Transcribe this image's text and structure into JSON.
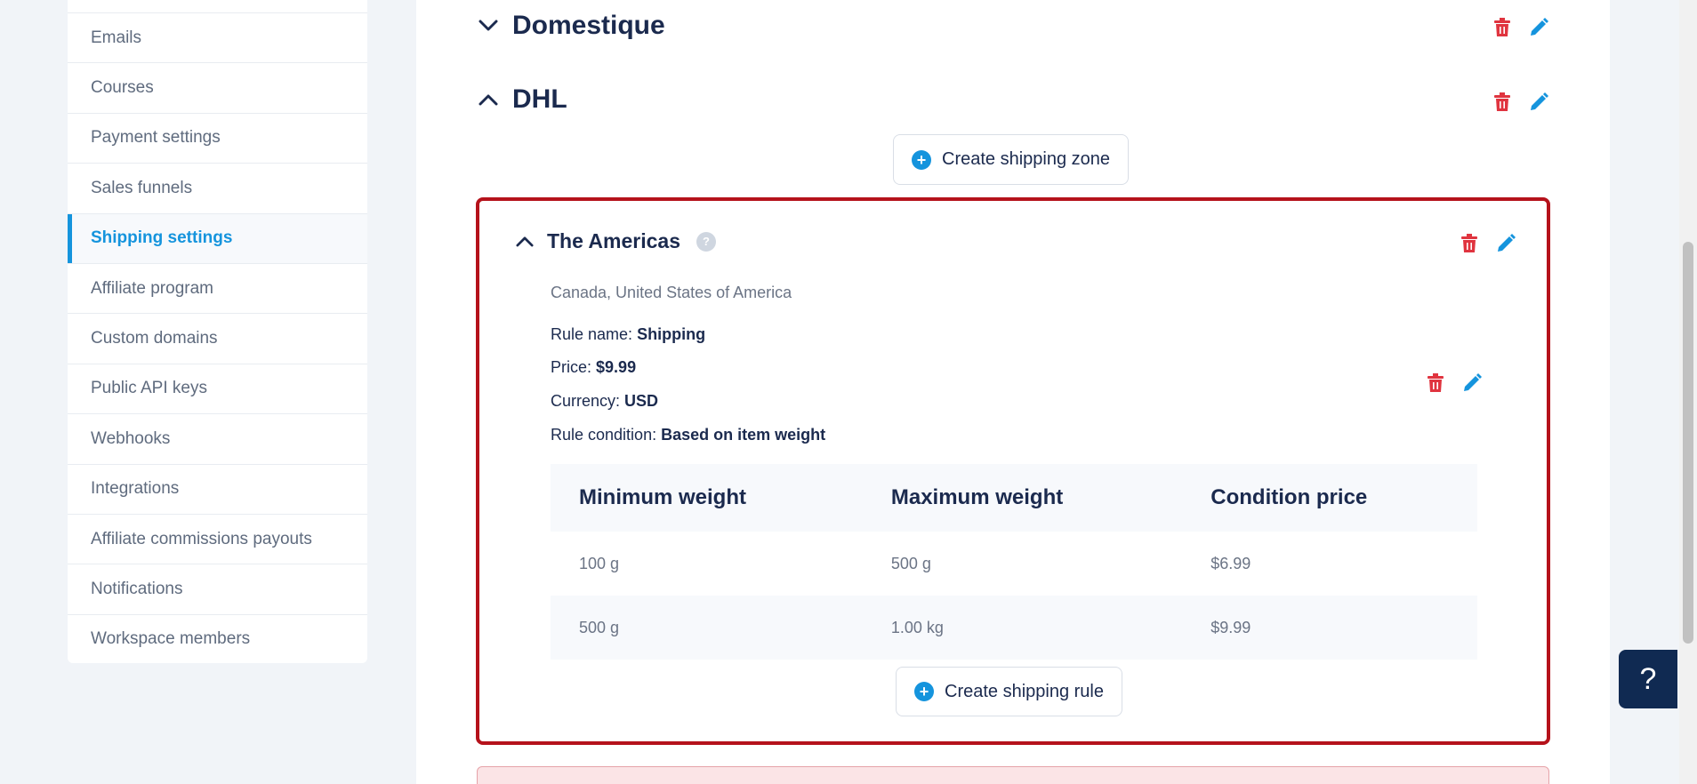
{
  "sidebar": {
    "items": [
      {
        "label": "Emails",
        "active": false
      },
      {
        "label": "Courses",
        "active": false
      },
      {
        "label": "Payment settings",
        "active": false
      },
      {
        "label": "Sales funnels",
        "active": false
      },
      {
        "label": "Shipping settings",
        "active": true
      },
      {
        "label": "Affiliate program",
        "active": false
      },
      {
        "label": "Custom domains",
        "active": false
      },
      {
        "label": "Public API keys",
        "active": false
      },
      {
        "label": "Webhooks",
        "active": false
      },
      {
        "label": "Integrations",
        "active": false
      },
      {
        "label": "Affiliate commissions payouts",
        "active": false
      },
      {
        "label": "Notifications",
        "active": false
      },
      {
        "label": "Workspace members",
        "active": false
      }
    ]
  },
  "groups": [
    {
      "name": "Domestique",
      "expanded": false
    },
    {
      "name": "DHL",
      "expanded": true
    }
  ],
  "create_zone_label": "Create shipping zone",
  "zone": {
    "name": "The Americas",
    "help": "?",
    "countries": "Canada, United States of America",
    "rule": {
      "name_label": "Rule name:",
      "name_value": "Shipping",
      "price_label": "Price:",
      "price_value": "$9.99",
      "currency_label": "Currency:",
      "currency_value": "USD",
      "condition_label": "Rule condition:",
      "condition_value": "Based on item weight"
    },
    "table": {
      "headers": [
        "Minimum weight",
        "Maximum weight",
        "Condition price"
      ],
      "rows": [
        [
          "100 g",
          "500 g",
          "$6.99"
        ],
        [
          "500 g",
          "1.00 kg",
          "$9.99"
        ]
      ]
    },
    "create_rule_label": "Create shipping rule"
  },
  "help_button": "?",
  "colors": {
    "accent": "#1594dd",
    "delete": "#e0343f",
    "highlight_border": "#b5121b",
    "navy": "#1b2a4e"
  }
}
